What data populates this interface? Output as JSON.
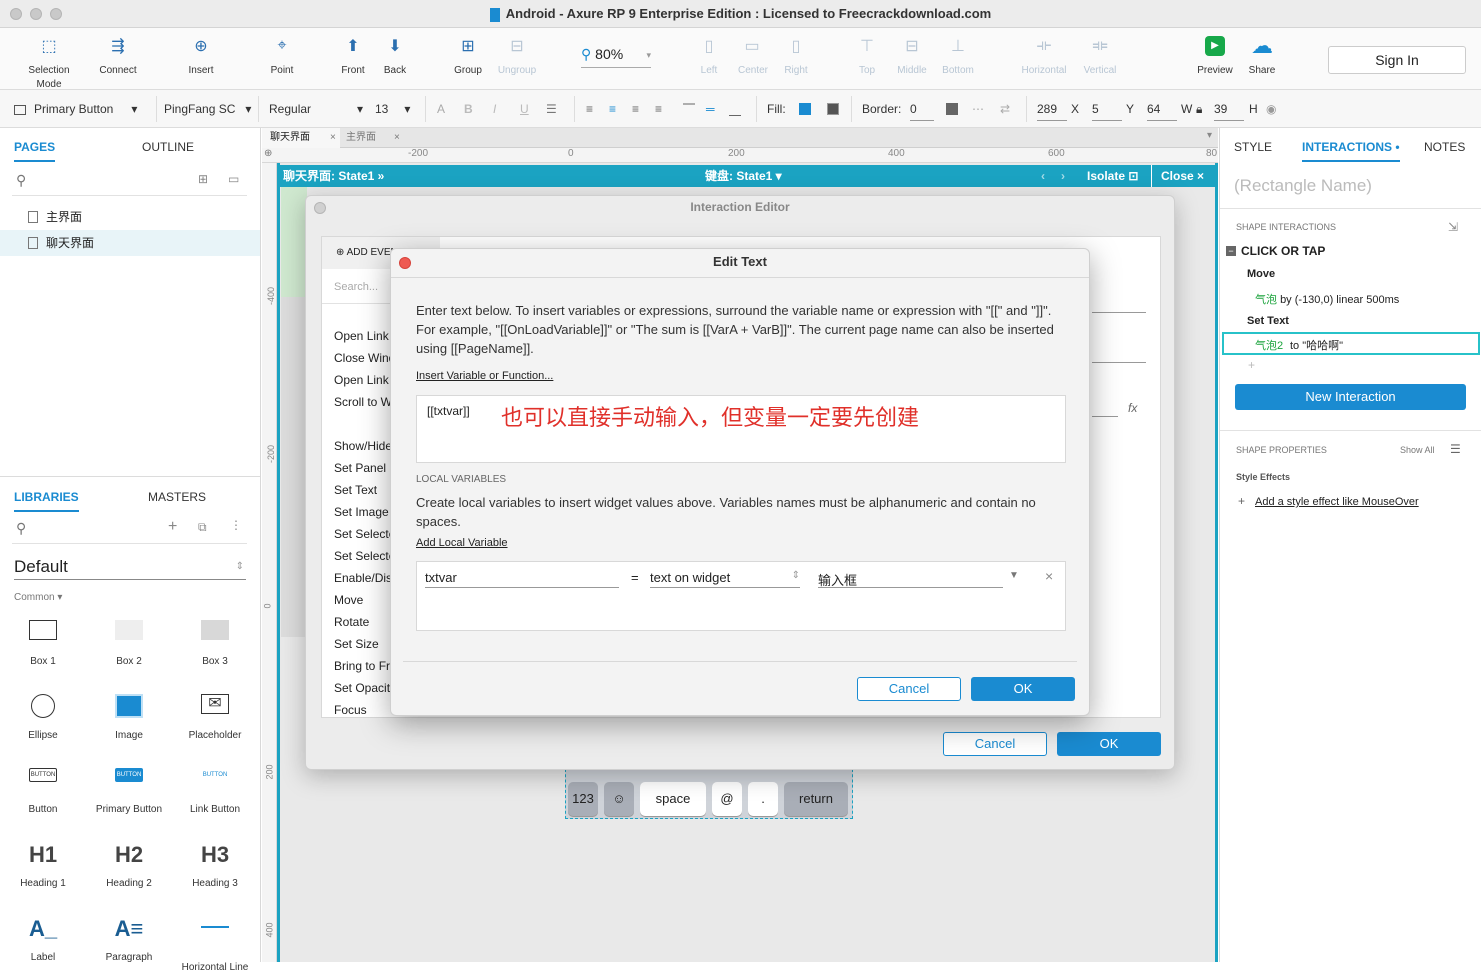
{
  "window": {
    "title": "Android - Axure RP 9 Enterprise Edition : Licensed to Freecrackdownload.com"
  },
  "toolbar": {
    "items": [
      {
        "label": "Selection Mode",
        "icon": "selection-mode-icon"
      },
      {
        "label": "Connect",
        "icon": "connect-icon"
      },
      {
        "label": "Insert",
        "icon": "insert-icon"
      },
      {
        "label": "Point",
        "icon": "point-icon"
      },
      {
        "label": "Front",
        "icon": "front-icon"
      },
      {
        "label": "Back",
        "icon": "back-icon"
      },
      {
        "label": "Group",
        "icon": "group-icon"
      },
      {
        "label": "Ungroup",
        "icon": "ungroup-icon"
      },
      {
        "label": "Left",
        "icon": "align-left-icon"
      },
      {
        "label": "Center",
        "icon": "align-center-icon"
      },
      {
        "label": "Right",
        "icon": "align-right-icon"
      },
      {
        "label": "Top",
        "icon": "align-top-icon"
      },
      {
        "label": "Middle",
        "icon": "align-middle-icon"
      },
      {
        "label": "Bottom",
        "icon": "align-bottom-icon"
      },
      {
        "label": "Horizontal",
        "icon": "distribute-horizontal-icon"
      },
      {
        "label": "Vertical",
        "icon": "distribute-vertical-icon"
      },
      {
        "label": "Preview",
        "icon": "preview-icon"
      },
      {
        "label": "Share",
        "icon": "share-cloud-icon"
      }
    ],
    "zoom": "80%",
    "sign_in": "Sign In"
  },
  "format": {
    "style": "Primary Button",
    "font": "PingFang SC",
    "weight": "Regular",
    "size": "13",
    "fill_label": "Fill:",
    "border_label": "Border:",
    "border_value": "0",
    "x": "289",
    "x_label": "X",
    "y": "5",
    "y_label": "Y",
    "w": "64",
    "w_label": "W",
    "h": "39",
    "h_label": "H"
  },
  "left": {
    "tab_pages": "PAGES",
    "tab_outline": "OUTLINE",
    "pages": [
      "主界面",
      "聊天界面"
    ],
    "tab_libraries": "LIBRARIES",
    "tab_masters": "MASTERS",
    "library": "Default",
    "category": "Common ▾",
    "widgets": [
      "Box 1",
      "Box 2",
      "Box 3",
      "Ellipse",
      "Image",
      "Placeholder",
      "Button",
      "Primary Button",
      "Link Button",
      "Heading 1",
      "Heading 2",
      "Heading 3",
      "Label",
      "Paragraph",
      "Horizontal Line"
    ]
  },
  "canvas": {
    "tabs": [
      "聊天界面",
      "主界面"
    ],
    "ruler_h": [
      "-200",
      "0",
      "200",
      "400",
      "600",
      "80"
    ],
    "ruler_v": [
      "-400",
      "-200",
      "0",
      "200",
      "400"
    ],
    "path_left": "聊天界面: State1  »",
    "path_mid": "键盘:  State1 ▾",
    "isolate": "Isolate",
    "close": "Close",
    "keys": [
      "123",
      "☺",
      "space",
      "@",
      ".",
      "return"
    ]
  },
  "interaction_editor": {
    "title": "Interaction Editor",
    "add_event": "ADD EVENT",
    "search_placeholder": "Search...",
    "actions": [
      "Open Link",
      "Close Window",
      "Open Link in Frame",
      "Scroll to Widget",
      "Show/Hide",
      "Set Panel State",
      "Set Text",
      "Set Image",
      "Set Selected",
      "Set Selected List",
      "Enable/Disable",
      "Move",
      "Rotate",
      "Set Size",
      "Bring to Front",
      "Set Opacity",
      "Focus"
    ],
    "cancel": "Cancel",
    "ok": "OK"
  },
  "edit_text": {
    "title": "Edit Text",
    "instructions": "Enter text below. To insert variables or expressions, surround the variable name or expression with \"[[\" and \"]]\". For example, \"[[OnLoadVariable]]\" or \"The sum is [[VarA + VarB]]\". The current page name can also be inserted using [[PageName]].",
    "insert_link": "Insert Variable or Function...",
    "text_value": "[[txtvar]]",
    "annotation": "也可以直接手动输入，但变量一定要先创建",
    "local_vars_header": "LOCAL VARIABLES",
    "local_vars_desc": "Create local variables to insert widget values above. Variables names must be alphanumeric and contain no spaces.",
    "add_local": "Add Local Variable",
    "var_name": "txtvar",
    "equals": "=",
    "var_type": "text on widget",
    "var_widget": "输入框",
    "cancel": "Cancel",
    "ok": "OK"
  },
  "right": {
    "tab_style": "STYLE",
    "tab_interactions": "INTERACTIONS •",
    "tab_notes": "NOTES",
    "shape_name_placeholder": "(Rectangle Name)",
    "shape_interactions": "SHAPE INTERACTIONS",
    "event": "CLICK OR TAP",
    "action1": "Move",
    "action1_target": "气泡",
    "action1_detail": "by (-130,0) linear 500ms",
    "action2": "Set Text",
    "action2_target": "气泡2",
    "action2_detail": "to \"哈哈啊\"",
    "new_interaction": "New Interaction",
    "shape_properties": "SHAPE PROPERTIES",
    "show_all": "Show All",
    "style_effects": "Style Effects",
    "add_effect": "Add a style effect like MouseOver"
  }
}
